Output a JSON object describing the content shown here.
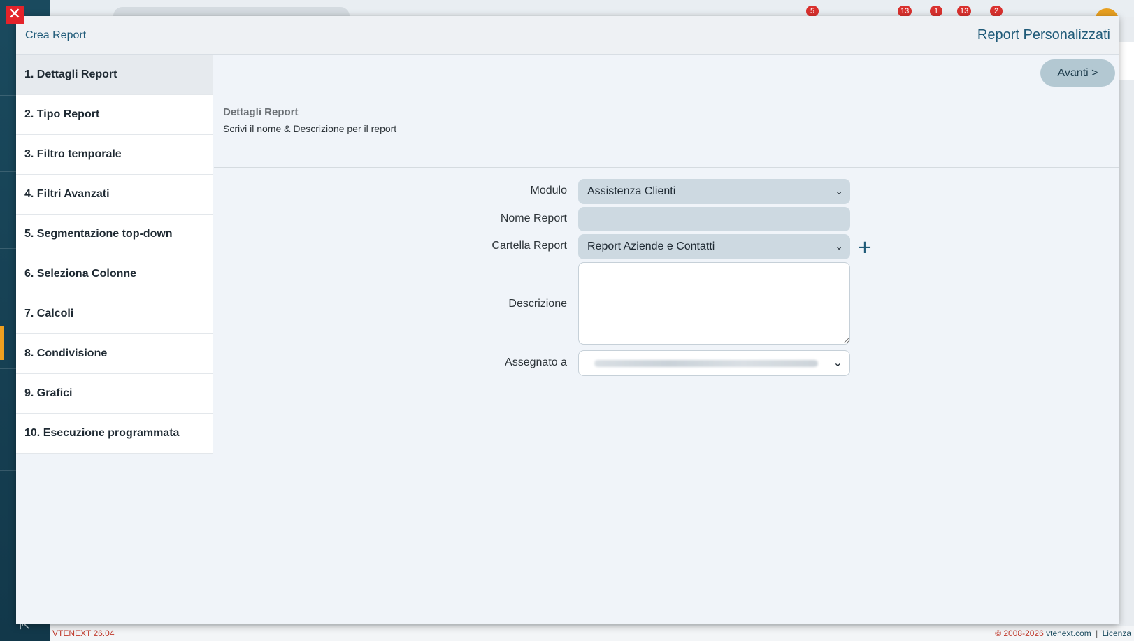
{
  "modal": {
    "breadcrumb": "Crea Report",
    "title": "Report Personalizzati",
    "next_label": "Avanti >"
  },
  "steps": [
    {
      "label": "1. Dettagli Report",
      "active": true
    },
    {
      "label": "2. Tipo Report"
    },
    {
      "label": "3. Filtro temporale"
    },
    {
      "label": "4. Filtri Avanzati"
    },
    {
      "label": "5. Segmentazione top-down"
    },
    {
      "label": "6. Seleziona Colonne"
    },
    {
      "label": "7. Calcoli"
    },
    {
      "label": "8. Condivisione"
    },
    {
      "label": "9. Grafici"
    },
    {
      "label": "10. Esecuzione programmata"
    }
  ],
  "section": {
    "title": "Dettagli Report",
    "subtitle": "Scrivi il nome & Descrizione per il report"
  },
  "form": {
    "module_label": "Modulo",
    "module_value": "Assistenza Clienti",
    "name_label": "Nome Report",
    "name_value": "",
    "folder_label": "Cartella Report",
    "folder_value": "Report Aziende e Contatti",
    "description_label": "Descrizione",
    "description_value": "",
    "assigned_label": "Assegnato a"
  },
  "topbar": {
    "badges": [
      "5",
      "13",
      "1",
      "13",
      "2"
    ]
  },
  "footer": {
    "version": "VTENEXT 26.04",
    "copyright": "© 2008-2026",
    "site": "vtenext.com",
    "separator": "|",
    "license": "Licenza"
  },
  "colors": {
    "primary": "#1f5a78",
    "close": "#e4232a",
    "badge": "#d9312e",
    "sidebar": "#1a4a5e",
    "accent": "#f0a020"
  }
}
